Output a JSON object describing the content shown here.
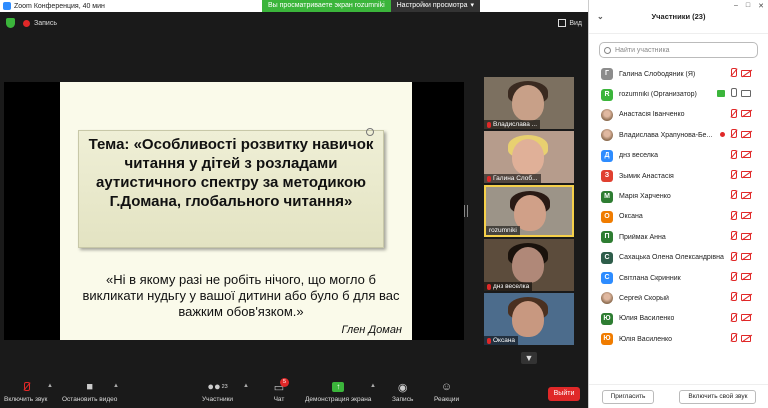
{
  "window": {
    "title": "Zoom Конференция, 40 мин"
  },
  "banner": {
    "viewing_text": "Вы просматриваете экран rozumniki",
    "view_settings": "Настройки просмотра"
  },
  "infobar": {
    "recording": "Запись",
    "view": "Вид"
  },
  "slide": {
    "topic": "Тема: «Особливості розвитку навичок читання у дітей з розладами аутистичного спектру за методикою Г.Домана, глобального читання»",
    "quote": "«Ні в якому разі не робіть нічого, що могло б викликати нудьгу у вашої дитини або було б для вас важким обов'язком.»",
    "author": "Глен Доман"
  },
  "tiles": [
    {
      "name": "Владислава ...",
      "muted": true
    },
    {
      "name": "Галина Слоб...",
      "muted": true
    },
    {
      "name": "rozumniki",
      "muted": false
    },
    {
      "name": "днз веселка",
      "muted": true
    },
    {
      "name": "Оксана",
      "muted": true
    }
  ],
  "toolbar": {
    "mute": "Включить звук",
    "video": "Остановить видео",
    "participants": "Участники",
    "participants_count": "23",
    "chat": "Чат",
    "chat_badge": "5",
    "share": "Демонстрация экрана",
    "record": "Запись",
    "reactions": "Реакции",
    "leave": "Выйти"
  },
  "colors": {
    "share_green": "#3bb53b",
    "leave_red": "#e02828",
    "zoom_blue": "#2d8cff"
  },
  "panel": {
    "title": "Участники (23)",
    "search_placeholder": "Найти участника",
    "participants": [
      {
        "initial": "Г",
        "color": "#8c8c8c",
        "name": "Галина Слободяник (Я)",
        "mic": "muted",
        "cam": "off",
        "share": false
      },
      {
        "initial": "R",
        "color": "#3bb53b",
        "name": "rozumniki (Организатор)",
        "mic": "on",
        "cam": "on",
        "share": true
      },
      {
        "initial": "",
        "color": "photo",
        "name": "Анастасія Іванченко",
        "mic": "muted",
        "cam": "off",
        "share": false
      },
      {
        "initial": "",
        "color": "photo",
        "name": "Владислава Храпунова-Бе...",
        "mic": "muted",
        "cam": "off",
        "share": false,
        "rec": true
      },
      {
        "initial": "Д",
        "color": "#2d8cff",
        "name": "днз веселка",
        "mic": "muted",
        "cam": "off",
        "share": false
      },
      {
        "initial": "З",
        "color": "#e04030",
        "name": "Зымик Анастасія",
        "mic": "muted",
        "cam": "off",
        "share": false
      },
      {
        "initial": "М",
        "color": "#2e7d32",
        "name": "Марія Харченко",
        "mic": "muted",
        "cam": "off",
        "share": false
      },
      {
        "initial": "О",
        "color": "#f07c00",
        "name": "Оксана",
        "mic": "muted",
        "cam": "off",
        "share": false
      },
      {
        "initial": "П",
        "color": "#2e7d32",
        "name": "Приймак Анна",
        "mic": "muted",
        "cam": "off",
        "share": false
      },
      {
        "initial": "С",
        "color": "#2e5d4a",
        "name": "Сахацька Олена Олександрівна",
        "mic": "muted",
        "cam": "off",
        "share": false
      },
      {
        "initial": "С",
        "color": "#2d8cff",
        "name": "Світлана Скринник",
        "mic": "muted",
        "cam": "off",
        "share": false
      },
      {
        "initial": "",
        "color": "photo",
        "name": "Сергей Скорый",
        "mic": "muted",
        "cam": "off",
        "share": false
      },
      {
        "initial": "Ю",
        "color": "#2e7d32",
        "name": "Юлия Василенко",
        "mic": "muted",
        "cam": "off",
        "share": false
      },
      {
        "initial": "Ю",
        "color": "#f07c00",
        "name": "Юлія Василенко",
        "mic": "muted",
        "cam": "off",
        "share": false
      }
    ],
    "invite": "Пригласить",
    "unmute_self": "Включить свой звук"
  }
}
